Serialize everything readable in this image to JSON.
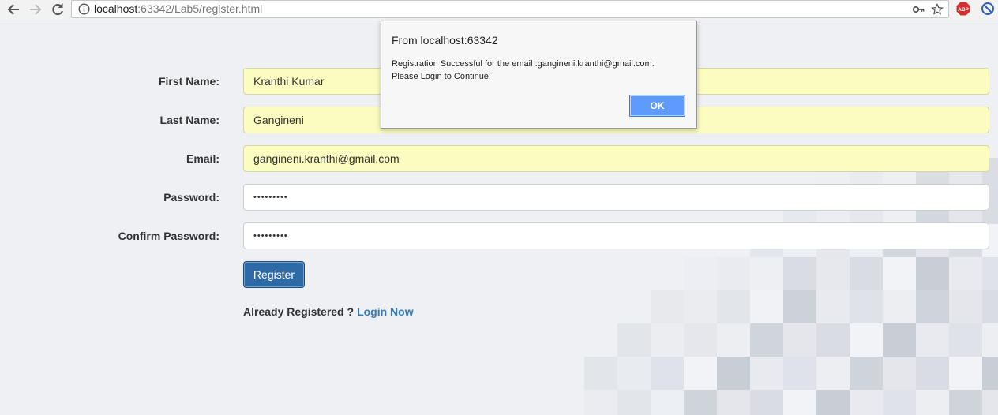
{
  "browser": {
    "url_host": "localhost",
    "url_rest": ":63342/Lab5/register.html",
    "extension_abp_label": "ABP"
  },
  "form": {
    "fields": [
      {
        "label": "First Name:",
        "value": "Kranthi Kumar",
        "type": "text",
        "autofilled": true
      },
      {
        "label": "Last Name:",
        "value": "Gangineni",
        "type": "text",
        "autofilled": true
      },
      {
        "label": "Email:",
        "value": "gangineni.kranthi@gmail.com",
        "type": "email",
        "autofilled": true
      },
      {
        "label": "Password:",
        "value": "•••••••••",
        "type": "password",
        "autofilled": false
      },
      {
        "label": "Confirm Password:",
        "value": "•••••••••",
        "type": "password",
        "autofilled": false
      }
    ],
    "register_label": "Register",
    "already_text": "Already Registered ?",
    "login_link": "Login Now"
  },
  "dialog": {
    "title": "From localhost:63342",
    "message_line1": "Registration Successful for the email :gangineni.kranthi@gmail.com.",
    "message_line2": "Please Login to Continue.",
    "ok_label": "OK"
  },
  "colors": {
    "primary_button": "#2d6aa6",
    "link": "#337ab7",
    "autofill_bg": "#fafcc0",
    "dialog_ok": "#5f9bfa"
  }
}
